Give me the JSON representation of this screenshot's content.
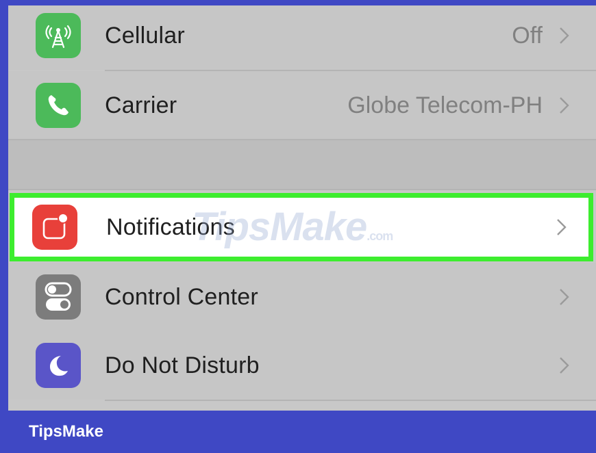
{
  "settings": {
    "cellular": {
      "label": "Cellular",
      "value": "Off",
      "icon": "cellular-antenna-icon",
      "color": "#4cba5a"
    },
    "carrier": {
      "label": "Carrier",
      "value": "Globe Telecom-PH",
      "icon": "phone-icon",
      "color": "#4cba5a"
    },
    "notifications": {
      "label": "Notifications",
      "icon": "notifications-icon",
      "color": "#e8403a",
      "highlight_color": "#3ded2f"
    },
    "control_center": {
      "label": "Control Center",
      "icon": "control-center-toggles-icon",
      "color": "#7c7c7c"
    },
    "do_not_disturb": {
      "label": "Do Not Disturb",
      "icon": "moon-icon",
      "color": "#5a55c8"
    }
  },
  "watermark": {
    "text": "TipsMake",
    "suffix": ".com"
  },
  "footer": {
    "brand": "TipsMake",
    "color": "#3f48c4"
  }
}
